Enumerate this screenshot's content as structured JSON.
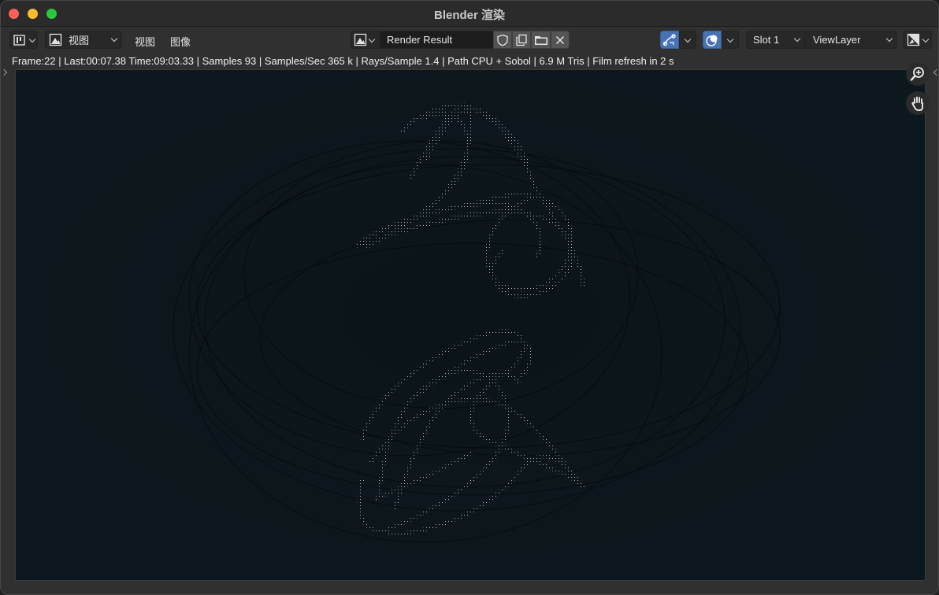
{
  "window": {
    "title": "Blender 渲染"
  },
  "header": {
    "editor_type_icon": "image-editor-icon",
    "view_selector_label": "视图",
    "menus": [
      "视图",
      "图像"
    ],
    "image_name": "Render Result",
    "slot": "Slot 1",
    "view_layer": "ViewLayer"
  },
  "status": {
    "text": "Frame:22 | Last:00:07.38 Time:09:03.33 | Samples 93 | Samples/Sec 365 k | Rays/Sample 1.4 | Path CPU + Sobol | 6.9 M Tris | Film refresh in 2 s"
  },
  "colors": {
    "accent_blue": "#4772b3",
    "viewport_bg": "#0b161b",
    "close": "#fe5f57",
    "minimize": "#febc2e",
    "maximize": "#28c840"
  },
  "icons": {
    "zoom": "zoom-in-icon",
    "pan": "hand-icon"
  }
}
